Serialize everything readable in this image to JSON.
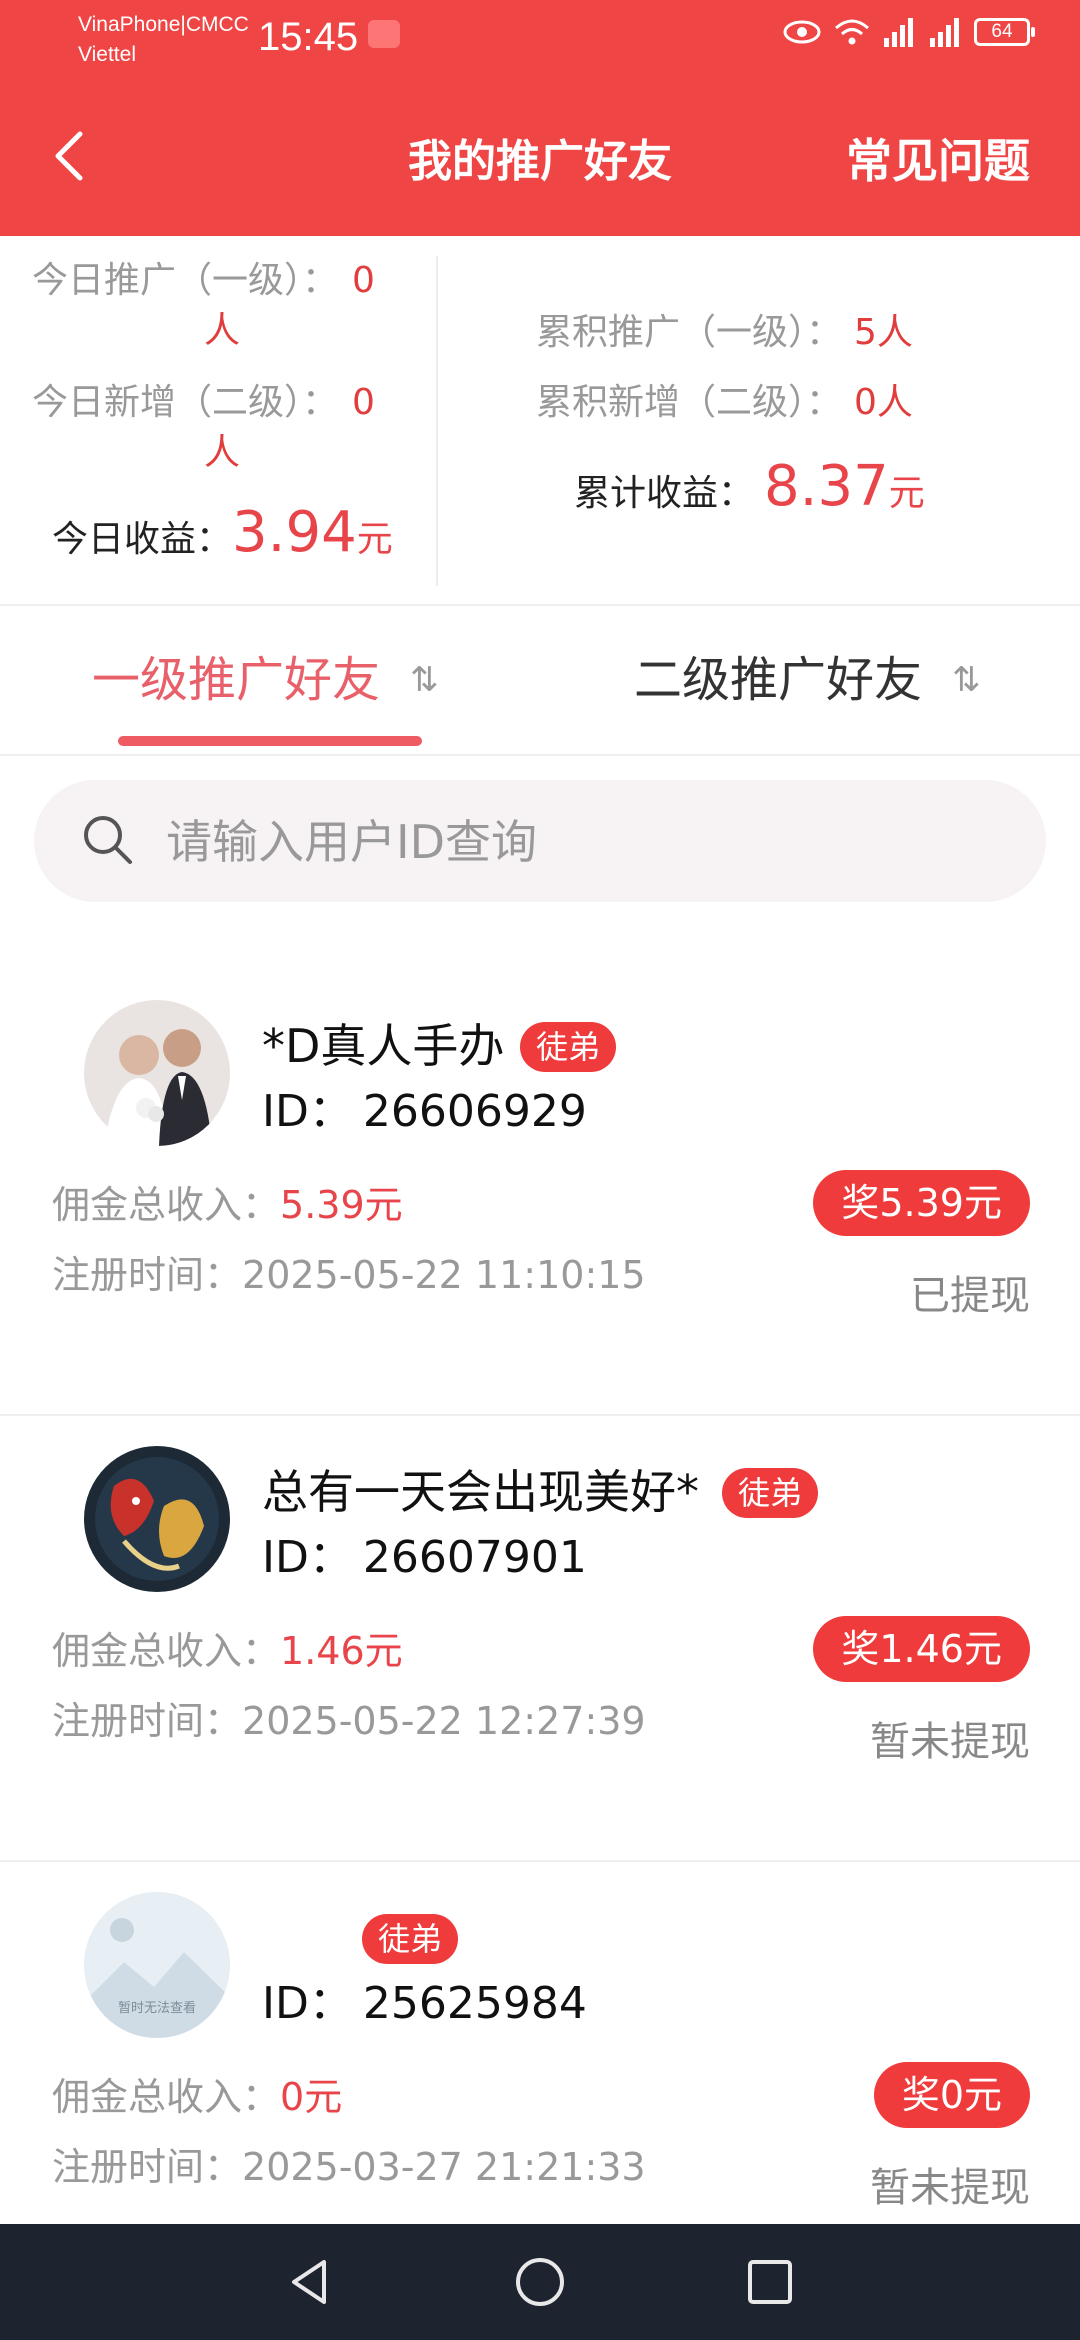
{
  "status_bar": {
    "carrier_line1": "VinaPhone|CMCC",
    "carrier_line2": "Viettel",
    "time": "15:45",
    "battery": "64"
  },
  "header": {
    "title": "我的推广好友",
    "faq_label": "常见问题"
  },
  "stats": {
    "today_promo_label": "今日推广（一级）：",
    "today_promo_value": "0",
    "today_promo_unit": "人",
    "today_new_label": "今日新增（二级）：",
    "today_new_value": "0",
    "today_new_unit": "人",
    "today_income_label": "今日收益：",
    "today_income_value": "3.94",
    "today_income_unit": "元",
    "total_promo_label": "累积推广（一级）：",
    "total_promo_value": "5人",
    "total_new_label": "累积新增（二级）：",
    "total_new_value": "0人",
    "total_income_label": "累计收益：",
    "total_income_value": "8.37",
    "total_income_unit": "元"
  },
  "tabs": [
    {
      "label": "一级推广好友",
      "sort_icon": "⇅",
      "active": true
    },
    {
      "label": "二级推广好友",
      "sort_icon": "⇅",
      "active": false
    }
  ],
  "search": {
    "placeholder": "请输入用户ID查询"
  },
  "friends": [
    {
      "name": "*D真人手办",
      "badge": "徒弟",
      "id_label": "ID：",
      "id": "26606929",
      "income_label": "佣金总收入：",
      "income": "5.39元",
      "reg_label": "注册时间：",
      "reg_time": "2025-05-22 11:10:15",
      "reward": "奖5.39元",
      "withdraw_status": "已提现"
    },
    {
      "name": "总有一天会出现美好*",
      "badge": "徒弟",
      "id_label": "ID：",
      "id": "26607901",
      "income_label": "佣金总收入：",
      "income": "1.46元",
      "reg_label": "注册时间：",
      "reg_time": "2025-05-22 12:27:39",
      "reward": "奖1.46元",
      "withdraw_status": "暂未提现"
    },
    {
      "name": "",
      "badge": "徒弟",
      "avatar_text": "暂时无法查看",
      "id_label": "ID：",
      "id": "25625984",
      "income_label": "佣金总收入：",
      "income": "0元",
      "reg_label": "注册时间：",
      "reg_time": "2025-03-27 21:21:33",
      "reward": "奖0元",
      "withdraw_status": "暂未提现"
    }
  ],
  "colors": {
    "header_bg": "#f04545",
    "accent_red": "#e8454b",
    "badge_red": "#ef3b3b",
    "nav_bg": "#1e2330"
  }
}
